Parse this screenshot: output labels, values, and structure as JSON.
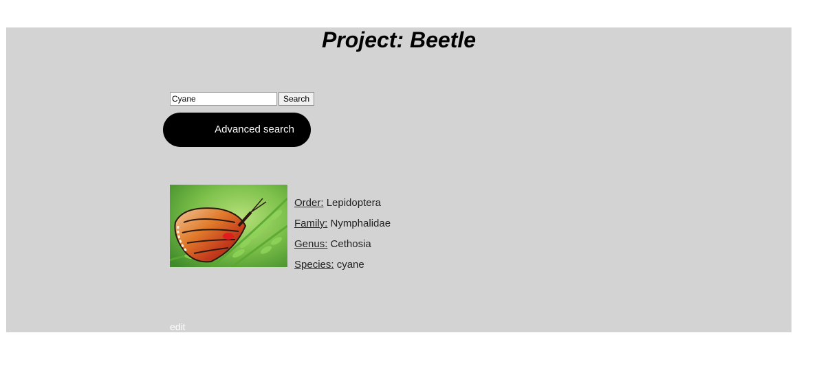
{
  "header": {
    "title": "Project: Beetle"
  },
  "search": {
    "value": "Cyane",
    "button_label": "Search",
    "advanced_label": "Advanced search"
  },
  "result": {
    "image_subject": "butterfly-on-fern",
    "fields": [
      {
        "key": "Order:",
        "value": "Lepidoptera"
      },
      {
        "key": "Family:",
        "value": "Nymphalidae"
      },
      {
        "key": "Genus:",
        "value": "Cethosia"
      },
      {
        "key": "Species:",
        "value": "cyane"
      }
    ],
    "edit_label": "edit"
  },
  "colors": {
    "panel_bg": "#d3d3d3",
    "advanced_button_bg": "#000000",
    "edit_link": "#ffffff"
  }
}
